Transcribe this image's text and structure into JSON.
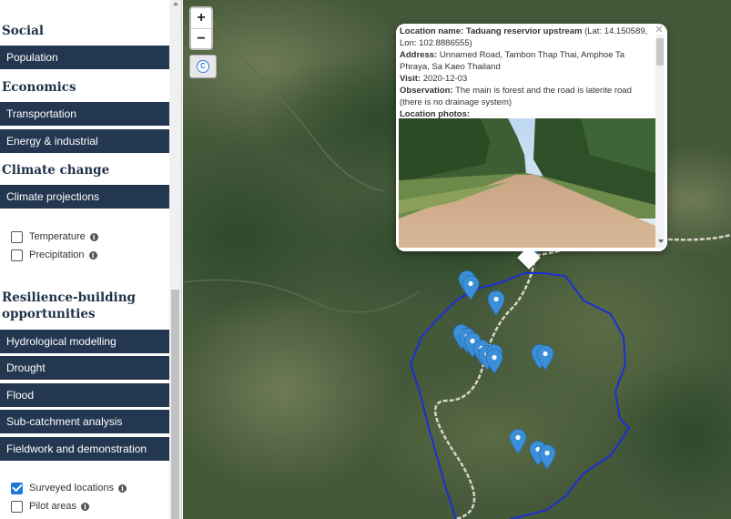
{
  "sidebar": {
    "social": {
      "heading": "Social",
      "items": [
        "Population"
      ]
    },
    "economics": {
      "heading": "Economics",
      "items": [
        "Transportation",
        "Energy & industrial"
      ]
    },
    "climate": {
      "heading": "Climate change",
      "items": [
        "Climate projections"
      ],
      "layers": [
        {
          "label": "Temperature",
          "checked": false
        },
        {
          "label": "Precipitation",
          "checked": false
        }
      ]
    },
    "resilience": {
      "heading": "Resilience-building opportunities",
      "items": [
        "Hydrological modelling",
        "Drought",
        "Flood",
        "Sub-catchment analysis",
        "Fieldwork and demonstration sites"
      ],
      "layers": [
        {
          "label": "Surveyed locations",
          "checked": true
        },
        {
          "label": "Pilot areas",
          "checked": false
        }
      ]
    }
  },
  "map": {
    "zoom_in": "+",
    "zoom_out": "−",
    "reset_label": "C",
    "marker_color": "#3b8fd9",
    "boundary_color": "#1c2fd4"
  },
  "popup": {
    "close": "✕",
    "name_label": "Location name:",
    "name_value": "Taduang reservior upstream",
    "coords": "(Lat: 14.150589, Lon: 102.8886555)",
    "address_label": "Address:",
    "address_value": "Unnamed Road, Tambon Thap Thai, Amphoe Ta Phraya, Sa Kaeo Thailand",
    "visit_label": "Visit:",
    "visit_value": "2020-12-03",
    "observation_label": "Observation:",
    "observation_value": "The main is forest and the road is laterite road (there is no drainage system)",
    "photos_label": "Location photos:"
  }
}
